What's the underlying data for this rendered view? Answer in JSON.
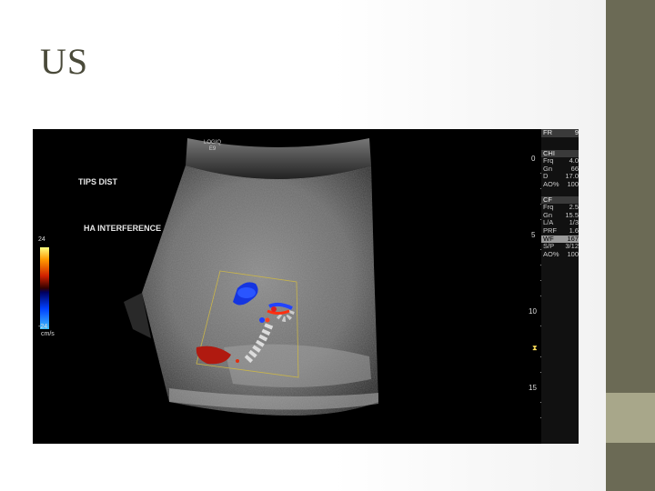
{
  "slide": {
    "title": "US"
  },
  "image": {
    "logo_line1": "LOGIQ",
    "logo_line2": "E9",
    "label_tips": "TIPS DIST",
    "label_ha": "HA INTERFERENCE",
    "color_scale": {
      "top": "24",
      "bottom": "-24",
      "unit": "cm/s"
    },
    "params": {
      "fr": {
        "label": "FR",
        "value": "9"
      },
      "chi": {
        "header": "CHI",
        "rows": [
          {
            "label": "Frq",
            "value": "4.0"
          },
          {
            "label": "Gn",
            "value": "66"
          },
          {
            "label": "D",
            "value": "17.0"
          },
          {
            "label": "AO%",
            "value": "100"
          }
        ]
      },
      "cf": {
        "header": "CF",
        "rows": [
          {
            "label": "Frq",
            "value": "2.5"
          },
          {
            "label": "Gn",
            "value": "15.5"
          },
          {
            "label": "L/A",
            "value": "1/3"
          },
          {
            "label": "PRF",
            "value": "1.6"
          },
          {
            "label": "WF",
            "value": "167",
            "highlight": true
          },
          {
            "label": "S/P",
            "value": "3/12"
          },
          {
            "label": "AO%",
            "value": "100"
          }
        ]
      }
    },
    "depth_marks": [
      "0",
      "5",
      "10",
      "15"
    ]
  },
  "colors": {
    "sidebar": "#6b6a55",
    "sidebar_accent": "#a8a78a",
    "title": "#4a4a3a"
  }
}
